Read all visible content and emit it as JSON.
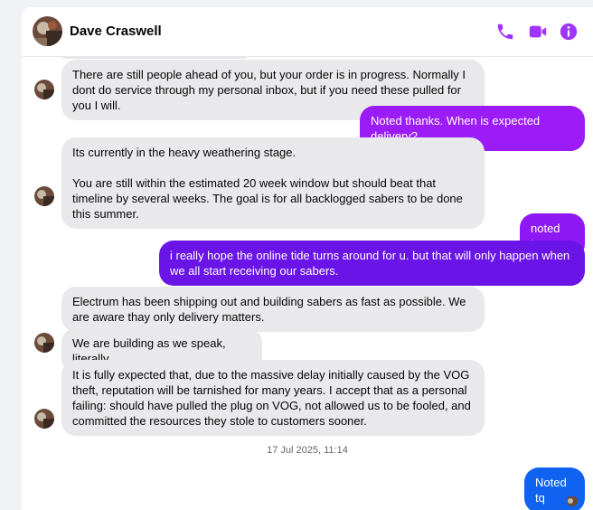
{
  "header": {
    "contact_name": "Dave Craswell",
    "icons": [
      "phone-icon",
      "video-camera-icon",
      "info-icon"
    ]
  },
  "colors": {
    "accent": "#a033ff",
    "outgoing_light": "#9b1cf6",
    "outgoing_dark": "#6a14e8",
    "outgoing_blue": "#1063f0",
    "incoming": "#e9e9eb"
  },
  "messages": [
    {
      "side": "in",
      "text": "There are still people ahead of you, but your order is in progress. Normally I dont do service through my personal inbox, but if you need these pulled for you I will."
    },
    {
      "side": "out",
      "text": "Noted thanks. When is expected delivery?"
    },
    {
      "side": "in",
      "text_p1": "Its currently in the heavy weathering stage.",
      "text_p2": "You are still within the estimated 20 week window but should beat that timeline by several weeks. The goal is for all backlogged sabers to be done this summer."
    },
    {
      "side": "out",
      "text": "noted tq."
    },
    {
      "side": "out",
      "text": "i really hope the online tide turns around for u. but that will only happen when we all start receiving our sabers."
    },
    {
      "side": "in",
      "text": "Electrum has been shipping out and building sabers as fast as possible. We are aware thay only delivery matters."
    },
    {
      "side": "in",
      "text": "We are building as we speak, literally."
    },
    {
      "side": "in",
      "text": "It is fully expected that, due to the massive delay initially caused by the VOG theft, reputation will be tarnished for many years. I accept that as a personal failing: should have pulled the plug on VOG, not allowed us to be fooled, and committed the resources they stole to customers sooner."
    },
    {
      "side": "out",
      "text": "Noted tq"
    }
  ],
  "timestamp": "17 Jul 2025, 11:14"
}
